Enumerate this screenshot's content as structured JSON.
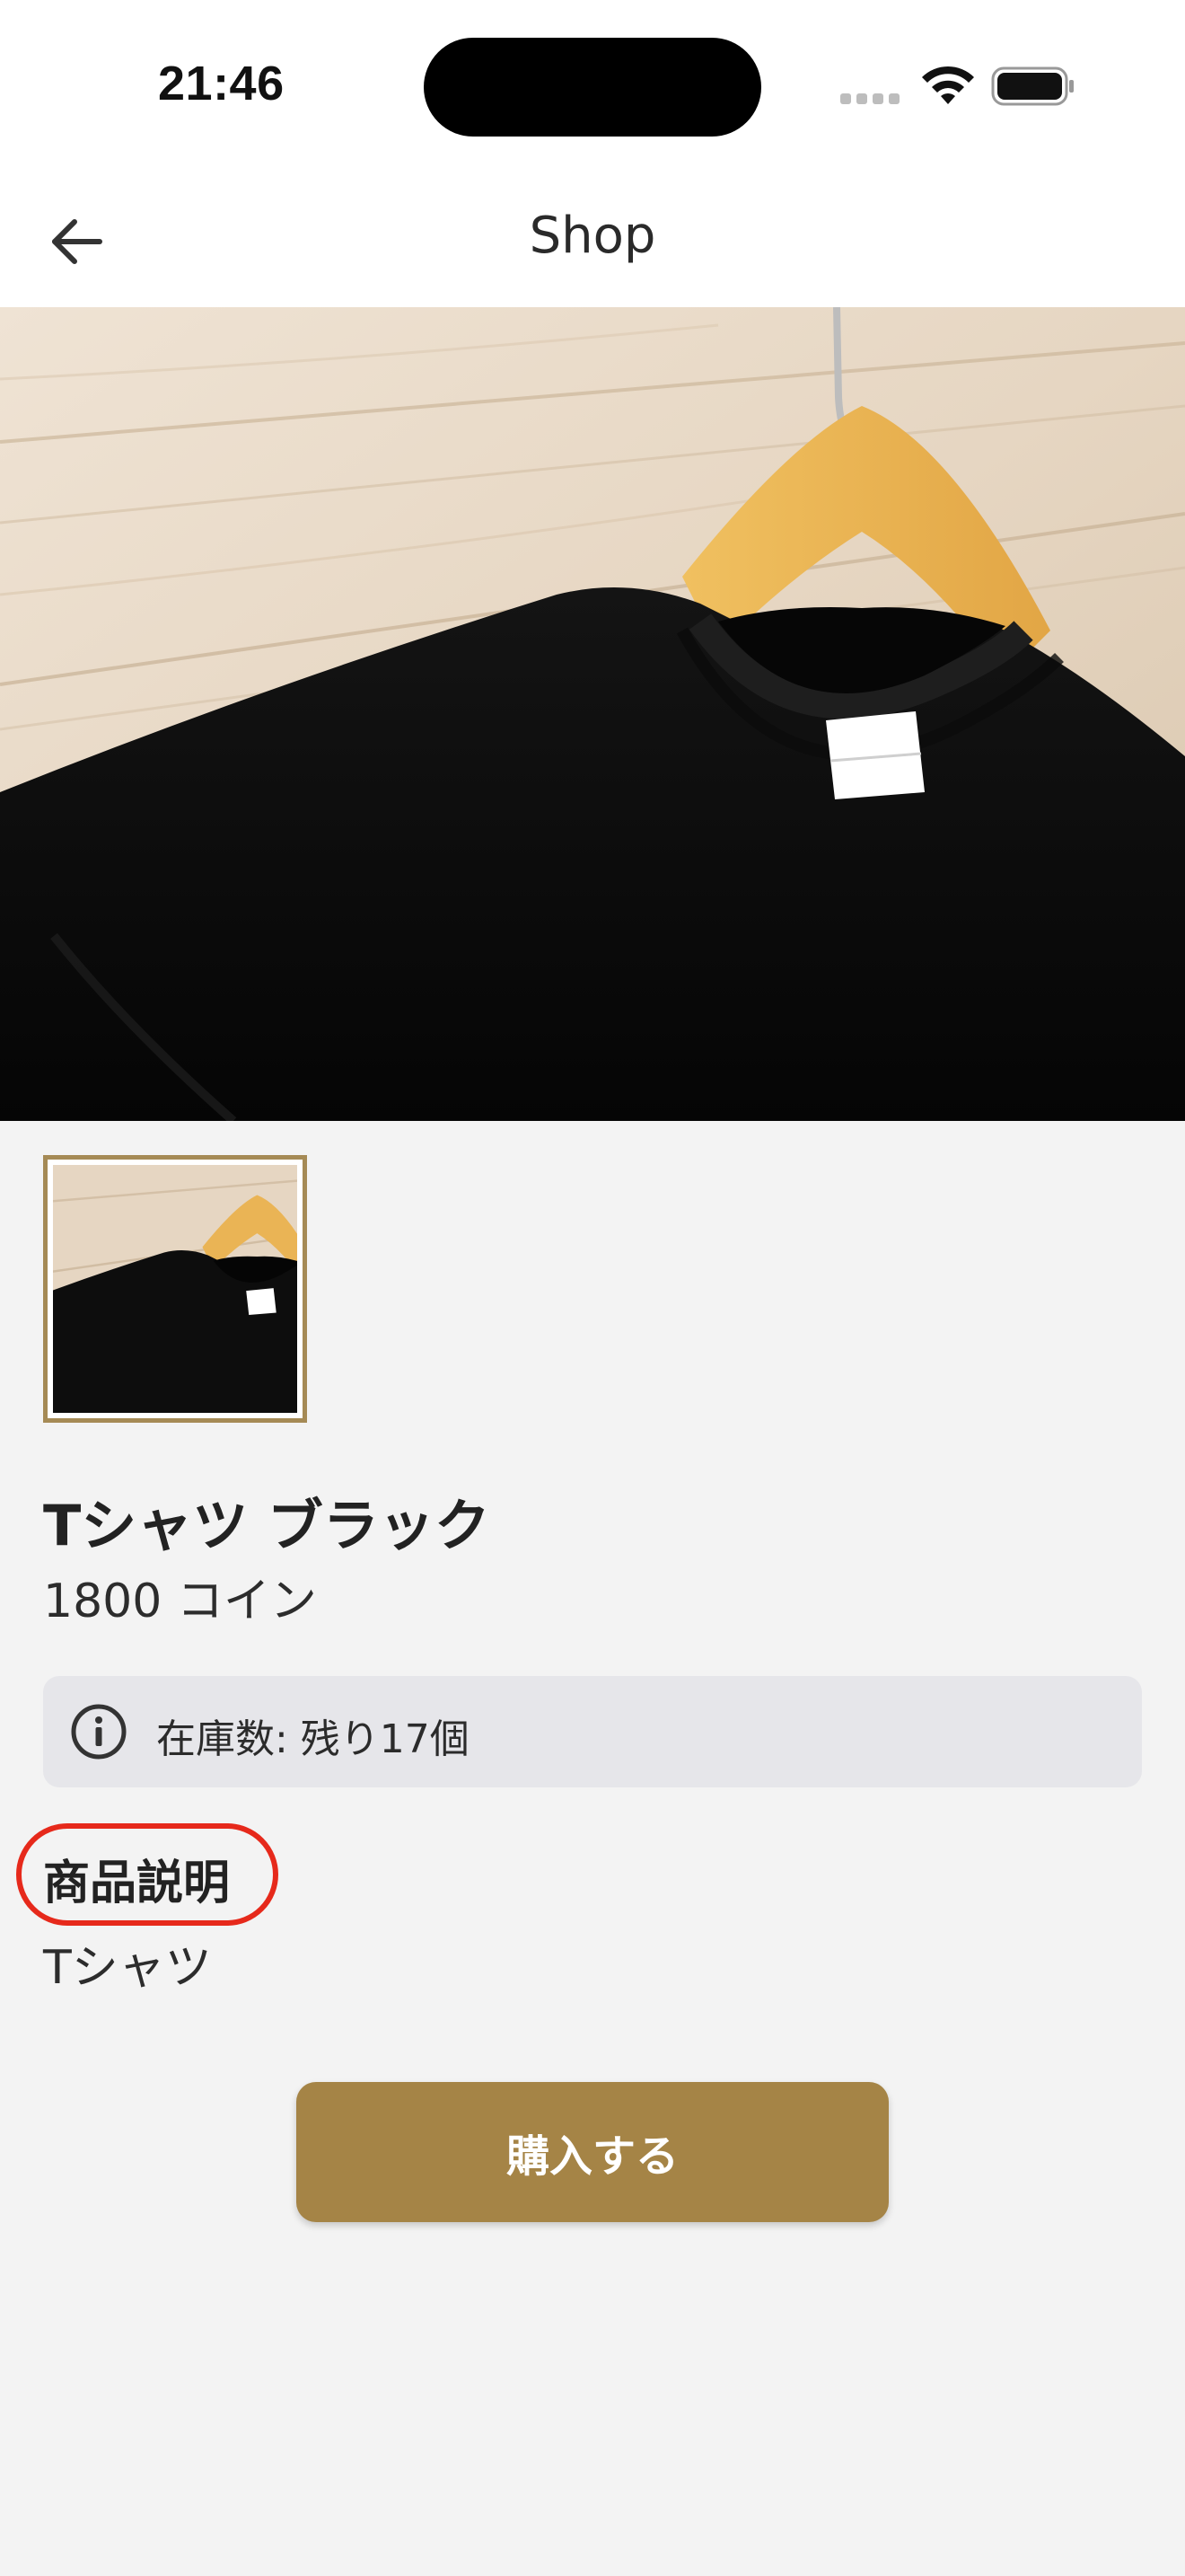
{
  "status_bar": {
    "time": "21:46",
    "icons": [
      "signal-icon",
      "wifi-icon",
      "battery-icon"
    ]
  },
  "nav": {
    "title": "Shop",
    "back_icon": "back-arrow-icon"
  },
  "product": {
    "name": "Tシャツ ブラック",
    "price": "1800 コイン",
    "stock": "在庫数: 残り17個",
    "stock_icon": "info-icon",
    "description_heading": "商品説明",
    "description": "Tシャツ"
  },
  "actions": {
    "purchase_label": "購入する"
  },
  "colors": {
    "accent": "#a58446",
    "thumbnail_border": "#a58a55",
    "highlight": "#e6291b",
    "background": "#f3f3f3",
    "stock_banner": "#e6e6ea"
  }
}
